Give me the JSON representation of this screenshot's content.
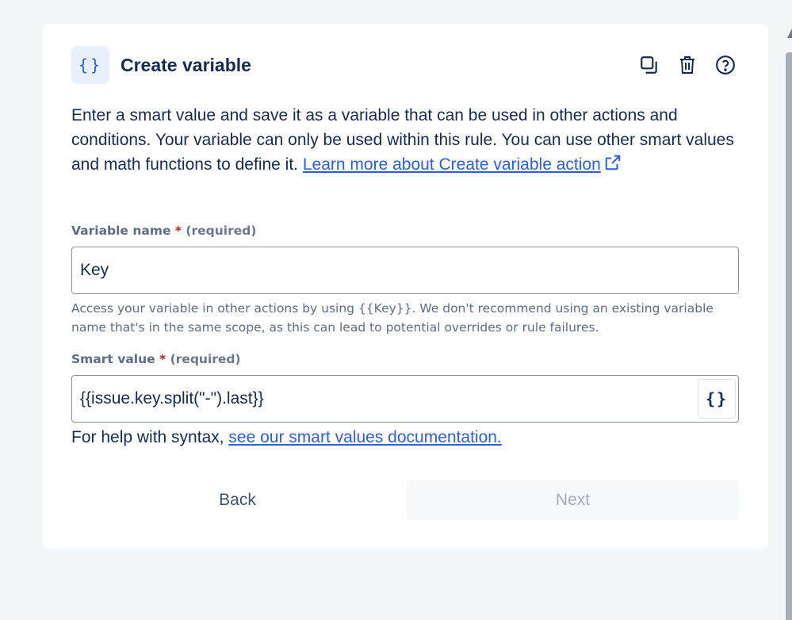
{
  "header": {
    "icon": "curly-braces-icon",
    "icon_glyph": "{}",
    "title": "Create variable",
    "actions": [
      "duplicate-icon",
      "delete-icon",
      "help-icon"
    ]
  },
  "description": {
    "text": "Enter a smart value and save it as a variable that can be used in other actions and conditions. Your variable can only be used within this rule. You can use other smart values and math functions to define it. ",
    "link_text": "Learn more about Create variable action"
  },
  "variable_name": {
    "label": "Variable name",
    "required_mark": "*",
    "required_text": "(required)",
    "value": "Key",
    "help": "Access your variable in other actions by using {{Key}}. We don't recommend using an existing variable name that's in the same scope, as this can lead to potential overrides or rule failures."
  },
  "smart_value": {
    "label": "Smart value",
    "required_mark": "*",
    "required_text": "(required)",
    "value": "{{issue.key.split(\"-\").last}}",
    "button_glyph": "{}"
  },
  "syntax_help": {
    "text": "For help with syntax, ",
    "link_text": "see our smart values documentation."
  },
  "footer": {
    "back_label": "Back",
    "next_label": "Next"
  },
  "colors": {
    "link": "#2f5fd6",
    "required": "#b3261e",
    "icon_bg": "#e9f0fd"
  }
}
